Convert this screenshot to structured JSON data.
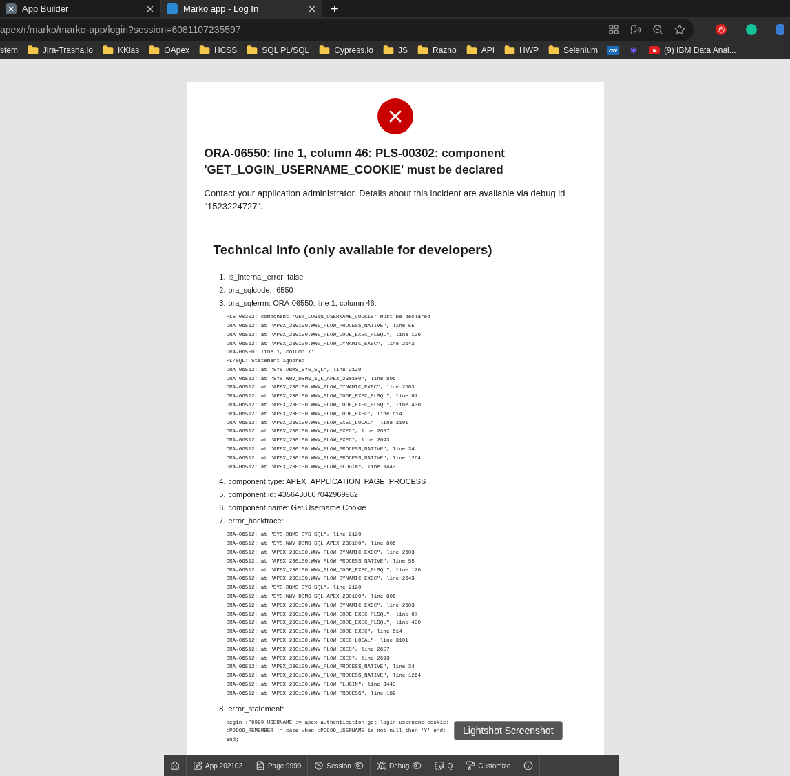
{
  "browser": {
    "tabs": [
      {
        "title": "App Builder",
        "selected": false
      },
      {
        "title": "Marko app - Log In",
        "selected": true
      }
    ],
    "new_tab": "+",
    "address": "apex/r/marko/marko-app/login?session=6081107235597",
    "bookmarks": [
      {
        "label": "stem",
        "kind": "text"
      },
      {
        "label": "Jira-Trasna.io",
        "kind": "folder"
      },
      {
        "label": "KKlas",
        "kind": "folder"
      },
      {
        "label": "OApex",
        "kind": "folder"
      },
      {
        "label": "HCSS",
        "kind": "folder"
      },
      {
        "label": "SQL PL/SQL",
        "kind": "folder"
      },
      {
        "label": "Cypress.io",
        "kind": "folder"
      },
      {
        "label": "JS",
        "kind": "folder"
      },
      {
        "label": "Razno",
        "kind": "folder"
      },
      {
        "label": "API",
        "kind": "folder"
      },
      {
        "label": "HWP",
        "kind": "folder"
      },
      {
        "label": "Selenium",
        "kind": "folder"
      },
      {
        "label": "cw",
        "kind": "badge"
      },
      {
        "kind": "star"
      },
      {
        "label": "(9) IBM Data Anal...",
        "kind": "video"
      }
    ]
  },
  "error": {
    "title": "ORA-06550: line 1, column 46: PLS-00302: component 'GET_LOGIN_USERNAME_COOKIE' must be declared",
    "message": "Contact your application administrator. Details about this incident are available via debug id \"1523224727\".",
    "technical": {
      "heading": "Technical Info (only available for developers)",
      "items": [
        {
          "number": "1.",
          "text": "is_internal_error: false"
        },
        {
          "number": "2.",
          "text": "ora_sqlcode: -6550"
        },
        {
          "number": "3.",
          "text": "ora_sqlerrm: ORA-06550: line 1, column 46:",
          "code": [
            "PLS-00302: component 'GET_LOGIN_USERNAME_COOKIE' must be declared",
            "ORA-06512: at \"APEX_230100.WWV_FLOW_PROCESS_NATIVE\", line 55",
            "ORA-06512: at \"APEX_230100.WWV_FLOW_CODE_EXEC_PLSQL\", line 126",
            "ORA-06512: at \"APEX_230100.WWV_FLOW_DYNAMIC_EXEC\", line 2643",
            "ORA-06550: line 1, column 7:",
            "PL/SQL: Statement ignored",
            "ORA-06512: at \"SYS.DBMS_SYS_SQL\", line 2120",
            "ORA-06512: at \"SYS.WWV_DBMS_SQL_APEX_230100\", line 806",
            "ORA-06512: at \"APEX_230100.WWV_FLOW_DYNAMIC_EXEC\", line 2603",
            "ORA-06512: at \"APEX_230100.WWV_FLOW_CODE_EXEC_PLSQL\", line 97",
            "ORA-06512: at \"APEX_230100.WWV_FLOW_CODE_EXEC_PLSQL\", line 430",
            "ORA-06512: at \"APEX_230100.WWV_FLOW_CODE_EXEC\", line 614",
            "ORA-06512: at \"APEX_230100.WWV_FLOW_EXEC_LOCAL\", line 3101",
            "ORA-06512: at \"APEX_230100.WWV_FLOW_EXEC\", line 2657",
            "ORA-06512: at \"APEX_230100.WWV_FLOW_EXEC\", line 2693",
            "ORA-06512: at \"APEX_230100.WWV_FLOW_PROCESS_NATIVE\", line 34",
            "ORA-06512: at \"APEX_230100.WWV_FLOW_PROCESS_NATIVE\", line 1264",
            "ORA-06512: at \"APEX_230100.WWV_FLOW_PLUGIN\", line 3443"
          ]
        },
        {
          "number": "4.",
          "text": "component.type: APEX_APPLICATION_PAGE_PROCESS"
        },
        {
          "number": "5.",
          "text": "component.id: 4356430007042969982"
        },
        {
          "number": "6.",
          "text": "component.name: Get Username Cookie"
        },
        {
          "number": "7.",
          "text": "error_backtrace:",
          "code": [
            "ORA-06512: at \"SYS.DBMS_SYS_SQL\", line 2120",
            "ORA-06512: at \"SYS.WWV_DBMS_SQL_APEX_230100\", line 806",
            "ORA-06512: at \"APEX_230100.WWV_FLOW_DYNAMIC_EXEC\", line 2603",
            "ORA-06512: at \"APEX_230100.WWV_FLOW_PROCESS_NATIVE\", line 55",
            "ORA-06512: at \"APEX_230100.WWV_FLOW_CODE_EXEC_PLSQL\", line 126",
            "ORA-06512: at \"APEX_230100.WWV_FLOW_DYNAMIC_EXEC\", line 2643",
            "ORA-06512: at \"SYS.DBMS_SYS_SQL\", line 2120",
            "ORA-06512: at \"SYS.WWV_DBMS_SQL_APEX_230100\", line 806",
            "ORA-06512: at \"APEX_230100.WWV_FLOW_DYNAMIC_EXEC\", line 2603",
            "ORA-06512: at \"APEX_230100.WWV_FLOW_CODE_EXEC_PLSQL\", line 97",
            "ORA-06512: at \"APEX_230100.WWV_FLOW_CODE_EXEC_PLSQL\", line 430",
            "ORA-06512: at \"APEX_230100.WWV_FLOW_CODE_EXEC\", line 614",
            "ORA-06512: at \"APEX_230100.WWV_FLOW_EXEC_LOCAL\", line 3101",
            "ORA-06512: at \"APEX_230100.WWV_FLOW_EXEC\", line 2657",
            "ORA-06512: at \"APEX_230100.WWV_FLOW_EXEC\", line 2693",
            "ORA-06512: at \"APEX_230100.WWV_FLOW_PROCESS_NATIVE\", line 34",
            "ORA-06512: at \"APEX_230100.WWV_FLOW_PROCESS_NATIVE\", line 1264",
            "ORA-06512: at \"APEX_230100.WWV_FLOW_PLUGIN\", line 3443",
            "ORA-06512: at \"APEX_230100.WWV_FLOW_PROCESS\", line 189"
          ]
        },
        {
          "number": "8.",
          "text": "error_statement:",
          "code": [
            "begin :P9999_USERNAME := apex_authentication.get_login_username_cookie;",
            ":P9999_REMEMBER := case when :P9999_USERNAME is not null then 'Y' end;",
            "end;"
          ]
        }
      ]
    }
  },
  "tooltip": "Lightshot Screenshot",
  "dev_toolbar": [
    {
      "kind": "home"
    },
    {
      "kind": "edit",
      "label": "App 202102"
    },
    {
      "kind": "page",
      "label": "Page 9999"
    },
    {
      "kind": "session",
      "label": "Session",
      "toggle": true
    },
    {
      "kind": "debug",
      "label": "Debug",
      "toggle": true
    },
    {
      "kind": "quick",
      "label": "Q"
    },
    {
      "kind": "customize",
      "label": "Customize"
    },
    {
      "kind": "info"
    }
  ]
}
